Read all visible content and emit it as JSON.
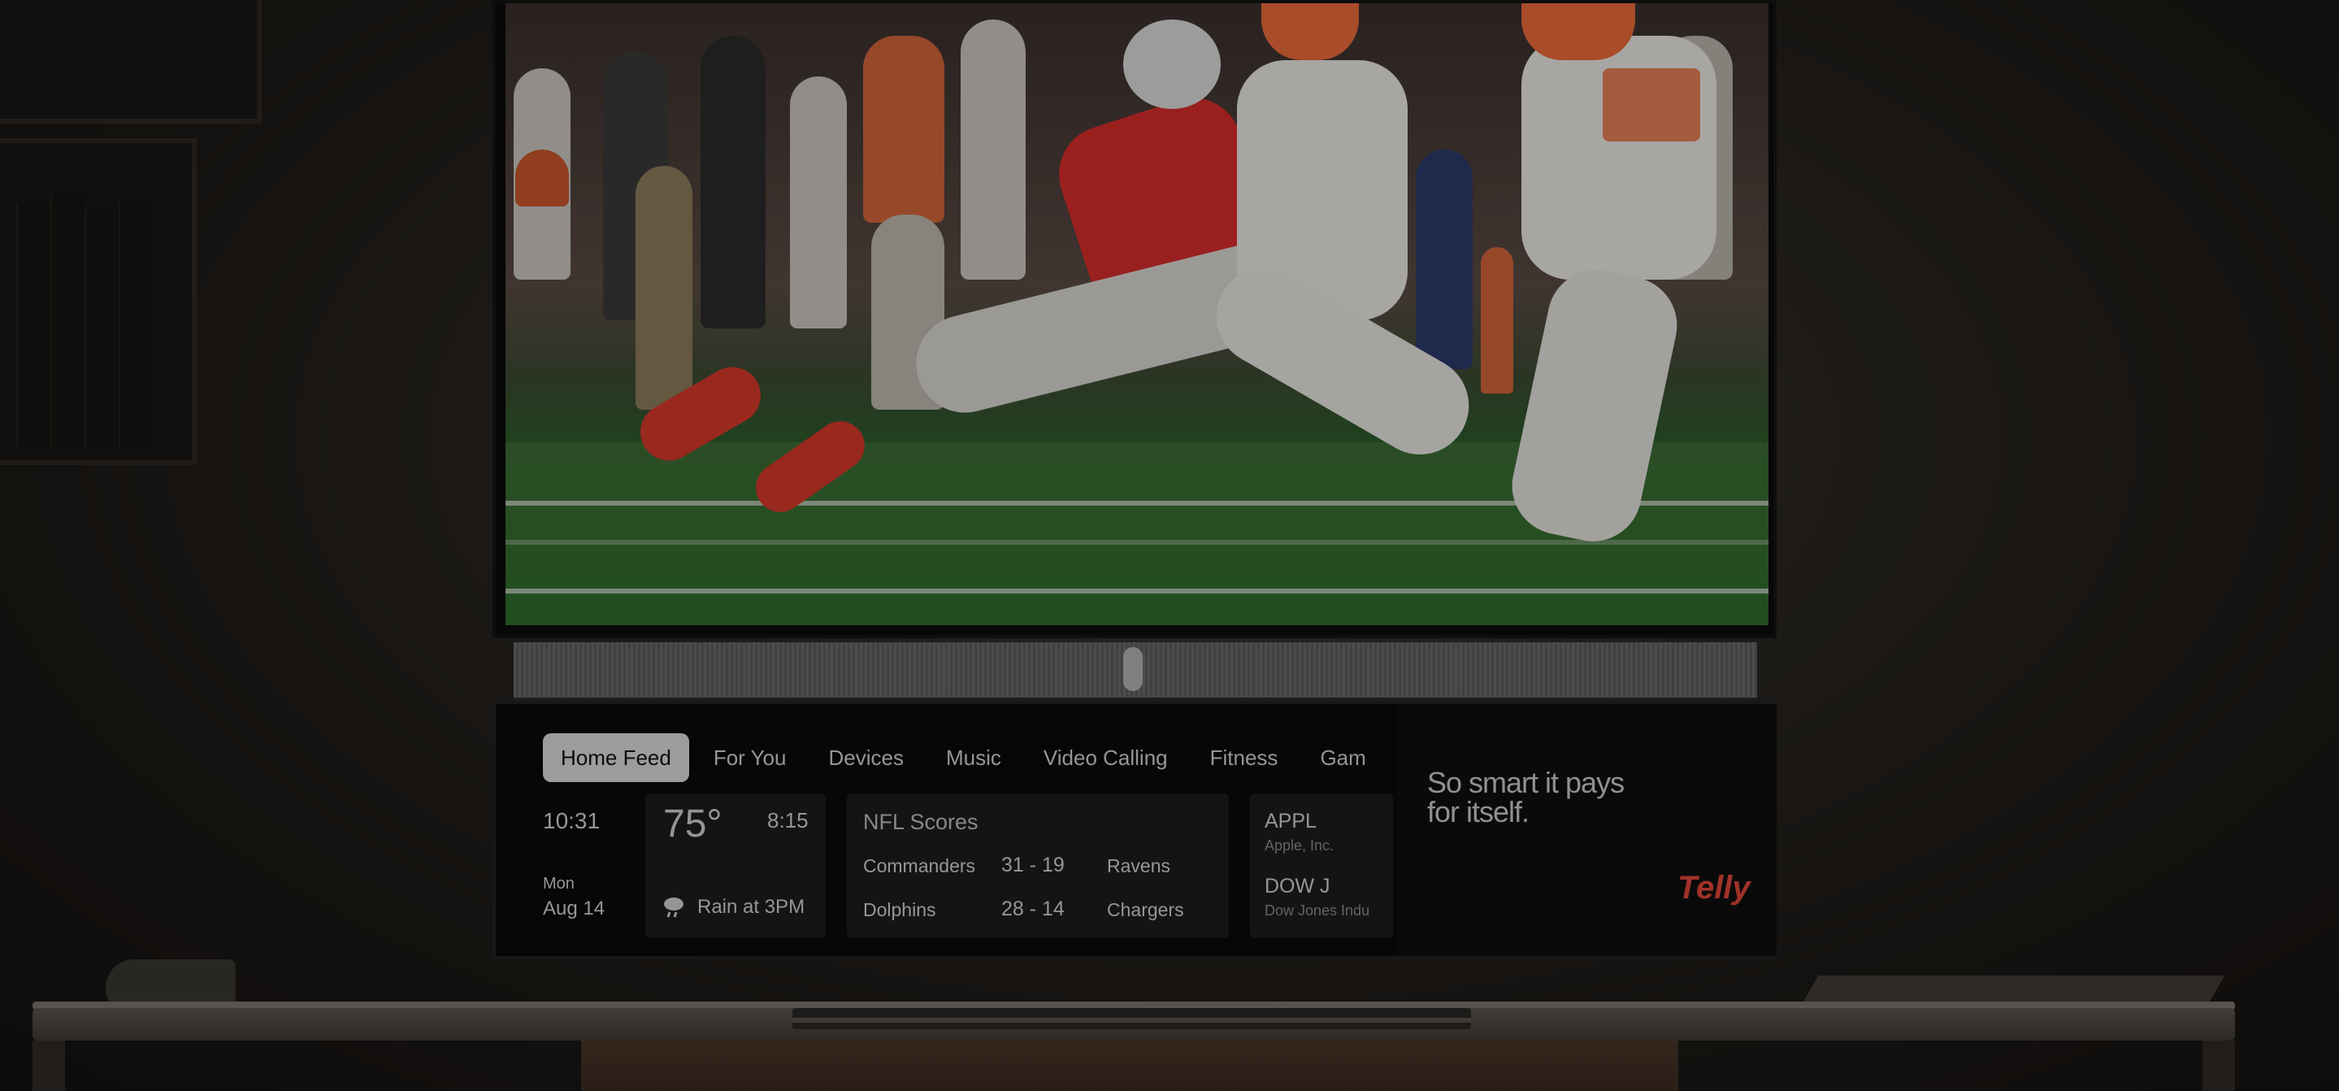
{
  "tabs": [
    {
      "label": "Home Feed",
      "active": true
    },
    {
      "label": "For You"
    },
    {
      "label": "Devices"
    },
    {
      "label": "Music"
    },
    {
      "label": "Video Calling"
    },
    {
      "label": "Fitness"
    },
    {
      "label": "Gam"
    }
  ],
  "clock": {
    "time": "10:31",
    "day": "Mon",
    "date": "Aug 14"
  },
  "weather": {
    "temp": "75°",
    "time": "8:15",
    "forecast": "Rain at 3PM",
    "icon": "rain-cloud-icon"
  },
  "nfl": {
    "title": "NFL Scores",
    "games": [
      {
        "home": "Commanders",
        "score": "31 - 19",
        "away": "Ravens"
      },
      {
        "home": "Dolphins",
        "score": "28 - 14",
        "away": "Chargers"
      }
    ]
  },
  "stocks": [
    {
      "symbol": "APPL",
      "name": "Apple, Inc."
    },
    {
      "symbol": "DOW J",
      "name": "Dow Jones Indu"
    }
  ],
  "ad": {
    "headline_line1": "So smart it pays",
    "headline_line2": "for itself.",
    "brand": "Telly"
  },
  "colors": {
    "brand": "#e0453a",
    "active_tab": "#d9d9d9",
    "panel": "#0a0a0a"
  }
}
